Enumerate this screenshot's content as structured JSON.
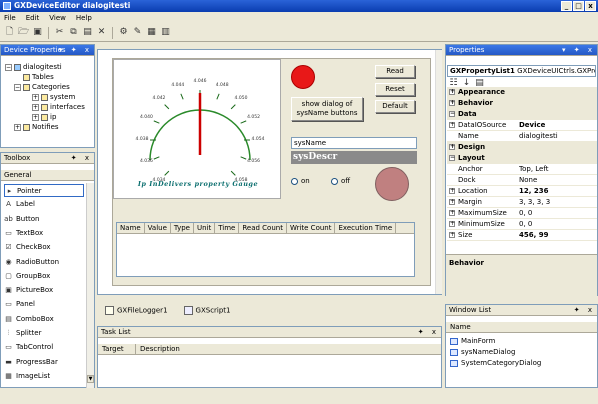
{
  "window": {
    "title": "GXDeviceEditor dialogitesti",
    "minimize": "_",
    "maximize": "□",
    "close": "x"
  },
  "menu": [
    "File",
    "Edit",
    "View",
    "Help"
  ],
  "device_properties": {
    "title": "Device Properties",
    "pin": "▾ ✦ x",
    "root": "dialogitesti",
    "tables": "Tables",
    "categories": "Categories",
    "system": "system",
    "interfaces": "interfaces",
    "ip": "ip",
    "notifies": "Notifies"
  },
  "toolbox": {
    "title": "Toolbox",
    "pin": "✦ x",
    "section": "General",
    "items": [
      {
        "label": "Pointer",
        "icon": "▸"
      },
      {
        "label": "Label",
        "icon": "A"
      },
      {
        "label": "Button",
        "icon": "ab"
      },
      {
        "label": "TextBox",
        "icon": "▭"
      },
      {
        "label": "CheckBox",
        "icon": "☑"
      },
      {
        "label": "RadioButton",
        "icon": "◉"
      },
      {
        "label": "GroupBox",
        "icon": "▢"
      },
      {
        "label": "PictureBox",
        "icon": "▣"
      },
      {
        "label": "Panel",
        "icon": "▭"
      },
      {
        "label": "ComboBox",
        "icon": "▤"
      },
      {
        "label": "Splitter",
        "icon": "⫶"
      },
      {
        "label": "TabControl",
        "icon": "▭"
      },
      {
        "label": "ProgressBar",
        "icon": "▬"
      },
      {
        "label": "ImageList",
        "icon": "▦"
      }
    ]
  },
  "form": {
    "read": "Read",
    "reset": "Reset",
    "default": "Default",
    "show_dialog": "show dialog of sysName buttons",
    "sysname": "sysName",
    "sysdescr": "sysDescr",
    "on": "on",
    "off": "off",
    "gauge_caption": "Ip InDelivers property Gauge",
    "gauge_labels": [
      "4.034",
      "4.036",
      "4.038",
      "4.040",
      "4.042",
      "4.044",
      "4.046",
      "4.048",
      "4.050",
      "4.052",
      "4.054",
      "4.056",
      "4.058"
    ],
    "grid_columns": [
      "Name",
      "Value",
      "Type",
      "Unit",
      "Time",
      "Read Count",
      "Write Count",
      "Execution Time"
    ],
    "indicator_red": "#e81818",
    "indicator_pink": "#c08080"
  },
  "doc_tabs": [
    "GXFileLogger1",
    "GXScript1"
  ],
  "task_list": {
    "title": "Task List",
    "pin": "✦ x",
    "columns": [
      "Target",
      "Description"
    ]
  },
  "properties": {
    "title": "Properties",
    "pin": "▾ ✦ x",
    "selector": "GXPropertyList1",
    "selector_type": "GXDeviceUICtrls.GXPro",
    "rows": [
      {
        "kind": "cat",
        "name": "Appearance",
        "box": "+"
      },
      {
        "kind": "cat",
        "name": "Behavior",
        "box": "+"
      },
      {
        "kind": "cat",
        "name": "Data",
        "box": "−"
      },
      {
        "kind": "prop",
        "name": "DataIOSource",
        "value": "Device",
        "box": "+",
        "bold": true
      },
      {
        "kind": "prop",
        "name": "Name",
        "value": "dialogitesti",
        "box": ""
      },
      {
        "kind": "cat",
        "name": "Design",
        "box": "+"
      },
      {
        "kind": "cat",
        "name": "Layout",
        "box": "−"
      },
      {
        "kind": "prop",
        "name": "Anchor",
        "value": "Top, Left",
        "box": ""
      },
      {
        "kind": "prop",
        "name": "Dock",
        "value": "None",
        "box": ""
      },
      {
        "kind": "prop",
        "name": "Location",
        "value": "12, 236",
        "box": "+",
        "bold": true
      },
      {
        "kind": "prop",
        "name": "Margin",
        "value": "3, 3, 3, 3",
        "box": "+"
      },
      {
        "kind": "prop",
        "name": "MaximumSize",
        "value": "0, 0",
        "box": "+"
      },
      {
        "kind": "prop",
        "name": "MinimumSize",
        "value": "0, 0",
        "box": "+"
      },
      {
        "kind": "prop",
        "name": "Size",
        "value": "456, 99",
        "box": "+",
        "bold": true
      }
    ],
    "description": "Behavior"
  },
  "window_list": {
    "title": "Window List",
    "pin": "✦ x",
    "column": "Name",
    "items": [
      "MainForm",
      "sysNameDialog",
      "SystemCategoryDialog"
    ]
  }
}
